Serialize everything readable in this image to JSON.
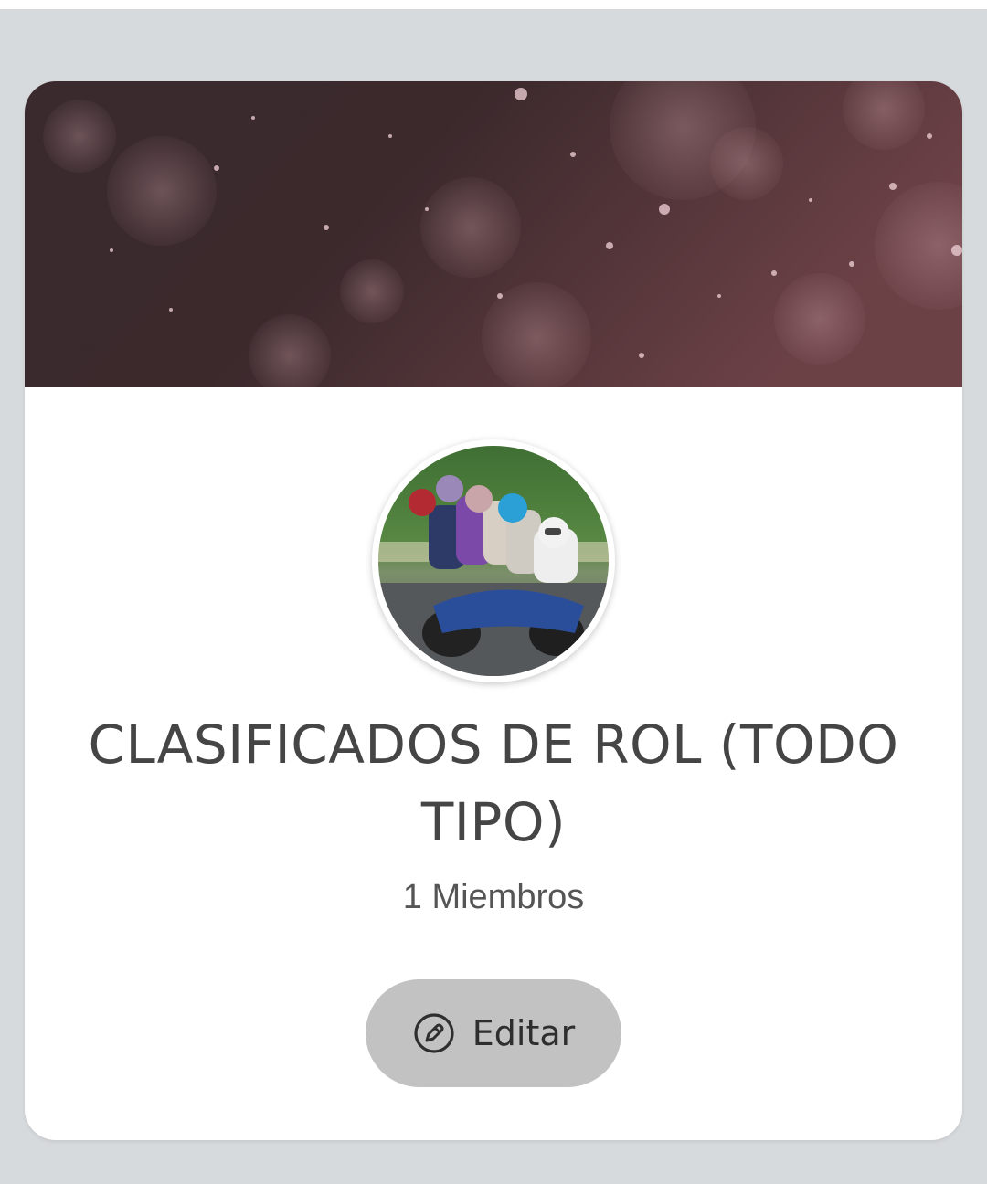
{
  "group": {
    "title": "CLASIFICADOS DE ROL (TODO TIPO)",
    "members": "1 Miembros"
  },
  "actions": {
    "edit_label": "Editar",
    "edit_icon": "edit-pencil-icon"
  },
  "colors": {
    "page_background": "#d7dadd",
    "card_background": "#ffffff",
    "button_background": "#c2c2c2",
    "title_text": "#454545",
    "banner_tone": "#4a3036"
  }
}
